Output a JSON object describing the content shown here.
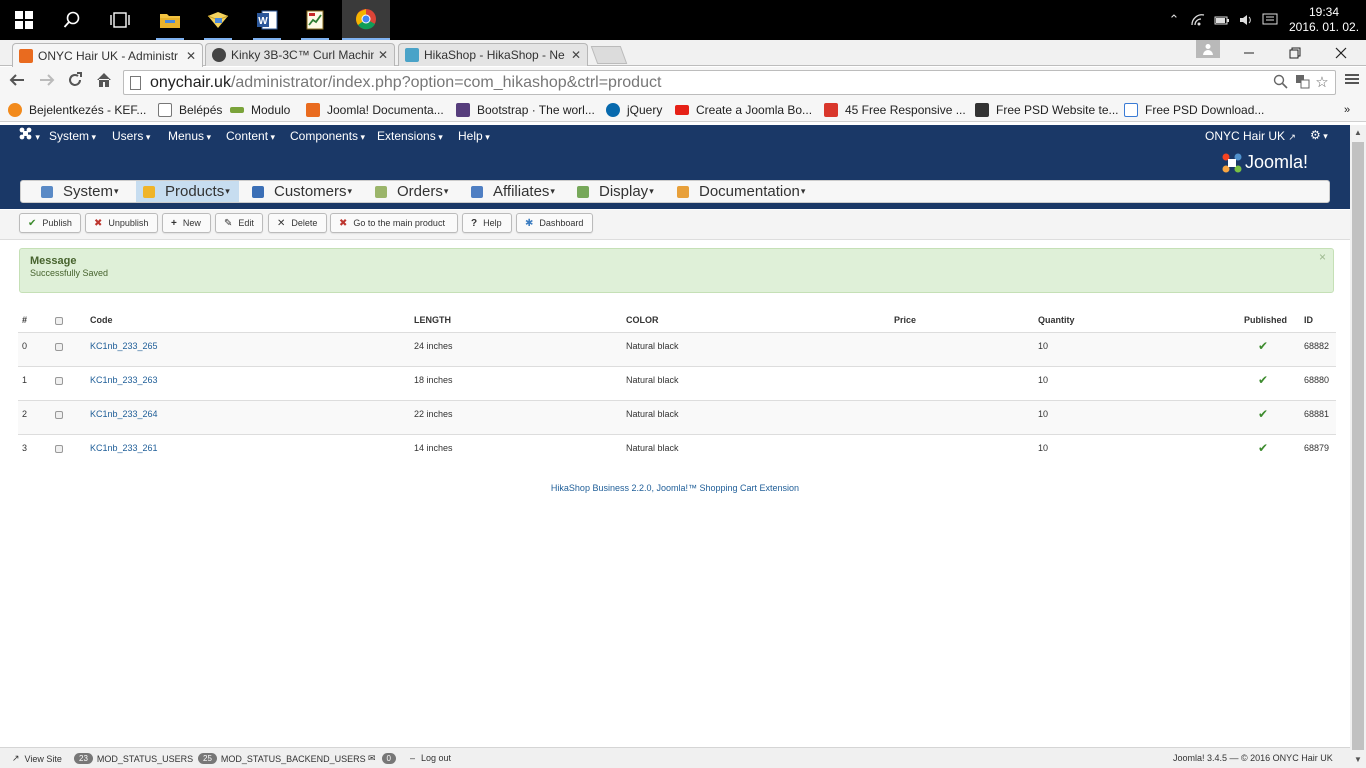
{
  "taskbar": {
    "clock_time": "19:34",
    "clock_date": "2016. 01. 02."
  },
  "tabs": [
    {
      "title": "ONYC Hair UK - Administr",
      "close": "✕",
      "color": "#e96b1f"
    },
    {
      "title": "Kinky 3B-3C™ Curl Machin",
      "close": "✕",
      "color": "#444444"
    },
    {
      "title": "HikaShop - HikaShop - Ne",
      "close": "✕",
      "color": "#4aa3c8"
    }
  ],
  "address": {
    "domain": "onychair.uk",
    "path": "/administrator/index.php?option=com_hikashop&ctrl=product"
  },
  "bookmarks": [
    {
      "label": "Bejelentkezés - KEF...",
      "color": "#f28a1c"
    },
    {
      "label": "Belépés",
      "color": "#ffffff"
    },
    {
      "label": "Modulo",
      "color": "#7aa33a"
    },
    {
      "label": "Joomla! Documenta...",
      "color": "#e96b1f"
    },
    {
      "label": "Bootstrap · The worl...",
      "color": "#563d7c"
    },
    {
      "label": "jQuery",
      "color": "#0769ad"
    },
    {
      "label": "Create a Joomla Bo...",
      "color": "#e62117"
    },
    {
      "label": "45 Free Responsive ...",
      "color": "#d9372b"
    },
    {
      "label": "Free PSD Website te...",
      "color": "#333333"
    },
    {
      "label": "Free PSD Download...",
      "color": "#3a7bd5"
    }
  ],
  "joomla_top": {
    "menus": [
      "System",
      "Users",
      "Menus",
      "Content",
      "Components",
      "Extensions",
      "Help"
    ],
    "site_name": "ONYC Hair UK",
    "logo_text": "Joomla!"
  },
  "hikamenu": [
    {
      "label": "System",
      "color": "#5a8ac6"
    },
    {
      "label": "Products",
      "color": "#f0b429"
    },
    {
      "label": "Customers",
      "color": "#3b6fb6"
    },
    {
      "label": "Orders",
      "color": "#9bb56a"
    },
    {
      "label": "Affiliates",
      "color": "#4f7fc3"
    },
    {
      "label": "Display",
      "color": "#77a85a"
    },
    {
      "label": "Documentation",
      "color": "#e8a03a"
    }
  ],
  "actions": [
    {
      "label": "Publish",
      "icon": "✔",
      "color": "#3d8b2e"
    },
    {
      "label": "Unpublish",
      "icon": "✖",
      "color": "#bd362f"
    },
    {
      "label": "New",
      "icon": "+",
      "color": "#333333"
    },
    {
      "label": "Edit",
      "icon": "✎",
      "color": "#333333"
    },
    {
      "label": "Delete",
      "icon": "✕",
      "color": "#333333"
    },
    {
      "label": "Go to the main product",
      "icon": "✖",
      "color": "#bd362f"
    },
    {
      "label": "Help",
      "icon": "?",
      "color": "#333333"
    },
    {
      "label": "Dashboard",
      "icon": "✱",
      "color": "#3b7cc0"
    }
  ],
  "message": {
    "heading": "Message",
    "text": "Successfully Saved",
    "close": "×"
  },
  "table": {
    "headers": {
      "num": "#",
      "code": "Code",
      "length": "LENGTH",
      "color": "COLOR",
      "price": "Price",
      "quantity": "Quantity",
      "published": "Published",
      "id": "ID"
    },
    "rows": [
      {
        "num": "0",
        "code": "KC1nb_233_265",
        "length": "24 inches",
        "color": "Natural black",
        "price": "",
        "quantity": "10",
        "published": "✔",
        "id": "68882"
      },
      {
        "num": "1",
        "code": "KC1nb_233_263",
        "length": "18 inches",
        "color": "Natural black",
        "price": "",
        "quantity": "10",
        "published": "✔",
        "id": "68880"
      },
      {
        "num": "2",
        "code": "KC1nb_233_264",
        "length": "22 inches",
        "color": "Natural black",
        "price": "",
        "quantity": "10",
        "published": "✔",
        "id": "68881"
      },
      {
        "num": "3",
        "code": "KC1nb_233_261",
        "length": "14 inches",
        "color": "Natural black",
        "price": "",
        "quantity": "10",
        "published": "✔",
        "id": "68879"
      }
    ]
  },
  "credit": "HikaShop Business 2.2.0, Joomla!™ Shopping Cart Extension",
  "statusbar": {
    "view_site": "View Site",
    "users_count": "23",
    "users_label": "MOD_STATUS_USERS",
    "backend_count": "25",
    "backend_label": "MOD_STATUS_BACKEND_USERS",
    "msg_count": "0",
    "logout": "Log out",
    "copyright": "Joomla! 3.4.5  —  © 2016 ONYC Hair UK"
  }
}
